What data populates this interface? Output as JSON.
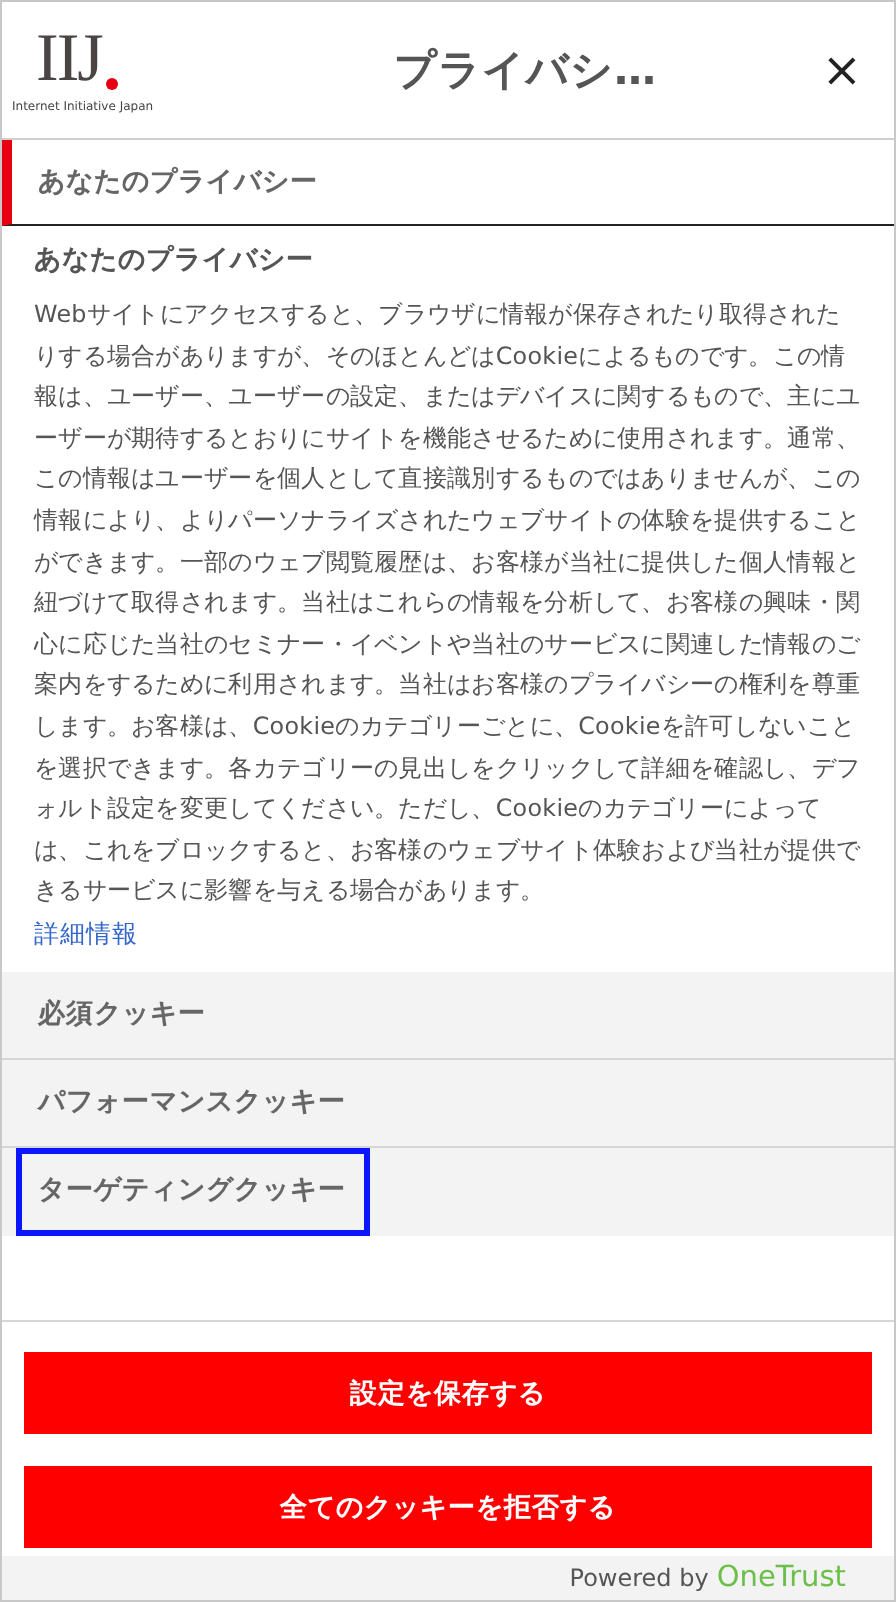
{
  "header": {
    "logo": "IIJ",
    "logo_tagline": "Internet Initiative Japan",
    "title": "プライバシ…",
    "close": "×"
  },
  "menu": [
    {
      "label": "あなたのプライバシー",
      "selected": true,
      "focused": false
    }
  ],
  "content": {
    "heading": "あなたのプライバシー",
    "body": "Webサイトにアクセスすると、ブラウザに情報が保存されたり取得されたりする場合がありますが、そのほとんどはCookieによるものです。この情報は、ユーザー、ユーザーの設定、またはデバイスに関するもので、主にユーザーが期待するとおりにサイトを機能させるために使用されます。通常、この情報はユーザーを個人として直接識別するものではありませんが、この情報により、よりパーソナライズされたウェブサイトの体験を提供することができます。一部のウェブ閲覧履歴は、お客様が当社に提供した個人情報と紐づけて取得されます。当社はこれらの情報を分析して、お客様の興味・関心に応じた当社のセミナー・イベントや当社のサービスに関連した情報のご案内をするために利用されます。当社はお客様のプライバシーの権利を尊重します。お客様は、Cookieのカテゴリーごとに、Cookieを許可しないことを選択できます。各カテゴリーの見出しをクリックして詳細を確認し、デフォルト設定を変更してください。ただし、Cookieのカテゴリーによっては、これをブロックすると、お客様のウェブサイト体験および当社が提供できるサービスに影響を与える場合があります。",
    "link": "詳細情報"
  },
  "categories": [
    {
      "label": "必須クッキー",
      "selected": false,
      "focused": false
    },
    {
      "label": "パフォーマンスクッキー",
      "selected": false,
      "focused": false
    },
    {
      "label": "ターゲティングクッキー",
      "selected": false,
      "focused": true
    }
  ],
  "buttons": [
    "設定を保存する",
    "全てのクッキーを拒否する"
  ],
  "footer": {
    "powered_by": "Powered by",
    "brand": "OneTrust"
  }
}
